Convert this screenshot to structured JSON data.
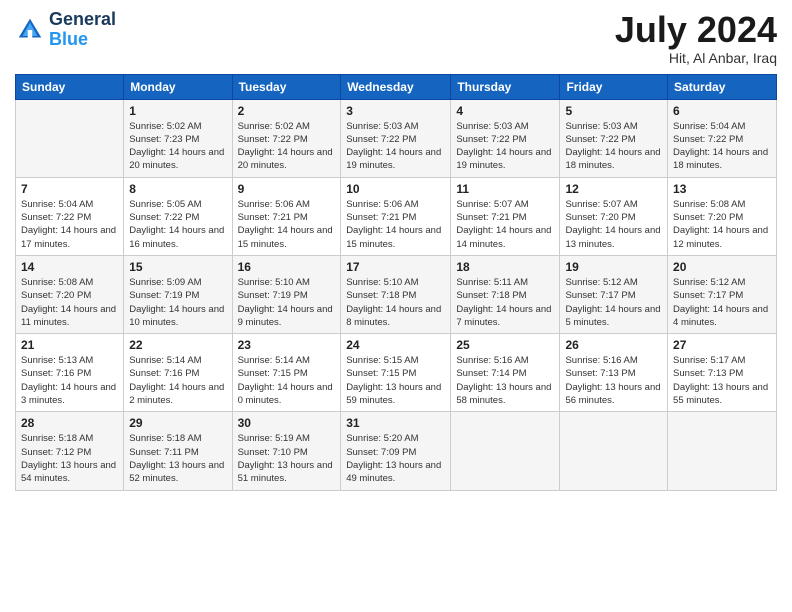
{
  "header": {
    "logo_line1": "General",
    "logo_line2": "Blue",
    "month_year": "July 2024",
    "location": "Hit, Al Anbar, Iraq"
  },
  "days_of_week": [
    "Sunday",
    "Monday",
    "Tuesday",
    "Wednesday",
    "Thursday",
    "Friday",
    "Saturday"
  ],
  "weeks": [
    [
      {
        "day": "",
        "info": ""
      },
      {
        "day": "1",
        "info": "Sunrise: 5:02 AM\nSunset: 7:23 PM\nDaylight: 14 hours\nand 20 minutes."
      },
      {
        "day": "2",
        "info": "Sunrise: 5:02 AM\nSunset: 7:22 PM\nDaylight: 14 hours\nand 20 minutes."
      },
      {
        "day": "3",
        "info": "Sunrise: 5:03 AM\nSunset: 7:22 PM\nDaylight: 14 hours\nand 19 minutes."
      },
      {
        "day": "4",
        "info": "Sunrise: 5:03 AM\nSunset: 7:22 PM\nDaylight: 14 hours\nand 19 minutes."
      },
      {
        "day": "5",
        "info": "Sunrise: 5:03 AM\nSunset: 7:22 PM\nDaylight: 14 hours\nand 18 minutes."
      },
      {
        "day": "6",
        "info": "Sunrise: 5:04 AM\nSunset: 7:22 PM\nDaylight: 14 hours\nand 18 minutes."
      }
    ],
    [
      {
        "day": "7",
        "info": "Sunrise: 5:04 AM\nSunset: 7:22 PM\nDaylight: 14 hours\nand 17 minutes."
      },
      {
        "day": "8",
        "info": "Sunrise: 5:05 AM\nSunset: 7:22 PM\nDaylight: 14 hours\nand 16 minutes."
      },
      {
        "day": "9",
        "info": "Sunrise: 5:06 AM\nSunset: 7:21 PM\nDaylight: 14 hours\nand 15 minutes."
      },
      {
        "day": "10",
        "info": "Sunrise: 5:06 AM\nSunset: 7:21 PM\nDaylight: 14 hours\nand 15 minutes."
      },
      {
        "day": "11",
        "info": "Sunrise: 5:07 AM\nSunset: 7:21 PM\nDaylight: 14 hours\nand 14 minutes."
      },
      {
        "day": "12",
        "info": "Sunrise: 5:07 AM\nSunset: 7:20 PM\nDaylight: 14 hours\nand 13 minutes."
      },
      {
        "day": "13",
        "info": "Sunrise: 5:08 AM\nSunset: 7:20 PM\nDaylight: 14 hours\nand 12 minutes."
      }
    ],
    [
      {
        "day": "14",
        "info": "Sunrise: 5:08 AM\nSunset: 7:20 PM\nDaylight: 14 hours\nand 11 minutes."
      },
      {
        "day": "15",
        "info": "Sunrise: 5:09 AM\nSunset: 7:19 PM\nDaylight: 14 hours\nand 10 minutes."
      },
      {
        "day": "16",
        "info": "Sunrise: 5:10 AM\nSunset: 7:19 PM\nDaylight: 14 hours\nand 9 minutes."
      },
      {
        "day": "17",
        "info": "Sunrise: 5:10 AM\nSunset: 7:18 PM\nDaylight: 14 hours\nand 8 minutes."
      },
      {
        "day": "18",
        "info": "Sunrise: 5:11 AM\nSunset: 7:18 PM\nDaylight: 14 hours\nand 7 minutes."
      },
      {
        "day": "19",
        "info": "Sunrise: 5:12 AM\nSunset: 7:17 PM\nDaylight: 14 hours\nand 5 minutes."
      },
      {
        "day": "20",
        "info": "Sunrise: 5:12 AM\nSunset: 7:17 PM\nDaylight: 14 hours\nand 4 minutes."
      }
    ],
    [
      {
        "day": "21",
        "info": "Sunrise: 5:13 AM\nSunset: 7:16 PM\nDaylight: 14 hours\nand 3 minutes."
      },
      {
        "day": "22",
        "info": "Sunrise: 5:14 AM\nSunset: 7:16 PM\nDaylight: 14 hours\nand 2 minutes."
      },
      {
        "day": "23",
        "info": "Sunrise: 5:14 AM\nSunset: 7:15 PM\nDaylight: 14 hours\nand 0 minutes."
      },
      {
        "day": "24",
        "info": "Sunrise: 5:15 AM\nSunset: 7:15 PM\nDaylight: 13 hours\nand 59 minutes."
      },
      {
        "day": "25",
        "info": "Sunrise: 5:16 AM\nSunset: 7:14 PM\nDaylight: 13 hours\nand 58 minutes."
      },
      {
        "day": "26",
        "info": "Sunrise: 5:16 AM\nSunset: 7:13 PM\nDaylight: 13 hours\nand 56 minutes."
      },
      {
        "day": "27",
        "info": "Sunrise: 5:17 AM\nSunset: 7:13 PM\nDaylight: 13 hours\nand 55 minutes."
      }
    ],
    [
      {
        "day": "28",
        "info": "Sunrise: 5:18 AM\nSunset: 7:12 PM\nDaylight: 13 hours\nand 54 minutes."
      },
      {
        "day": "29",
        "info": "Sunrise: 5:18 AM\nSunset: 7:11 PM\nDaylight: 13 hours\nand 52 minutes."
      },
      {
        "day": "30",
        "info": "Sunrise: 5:19 AM\nSunset: 7:10 PM\nDaylight: 13 hours\nand 51 minutes."
      },
      {
        "day": "31",
        "info": "Sunrise: 5:20 AM\nSunset: 7:09 PM\nDaylight: 13 hours\nand 49 minutes."
      },
      {
        "day": "",
        "info": ""
      },
      {
        "day": "",
        "info": ""
      },
      {
        "day": "",
        "info": ""
      }
    ]
  ]
}
